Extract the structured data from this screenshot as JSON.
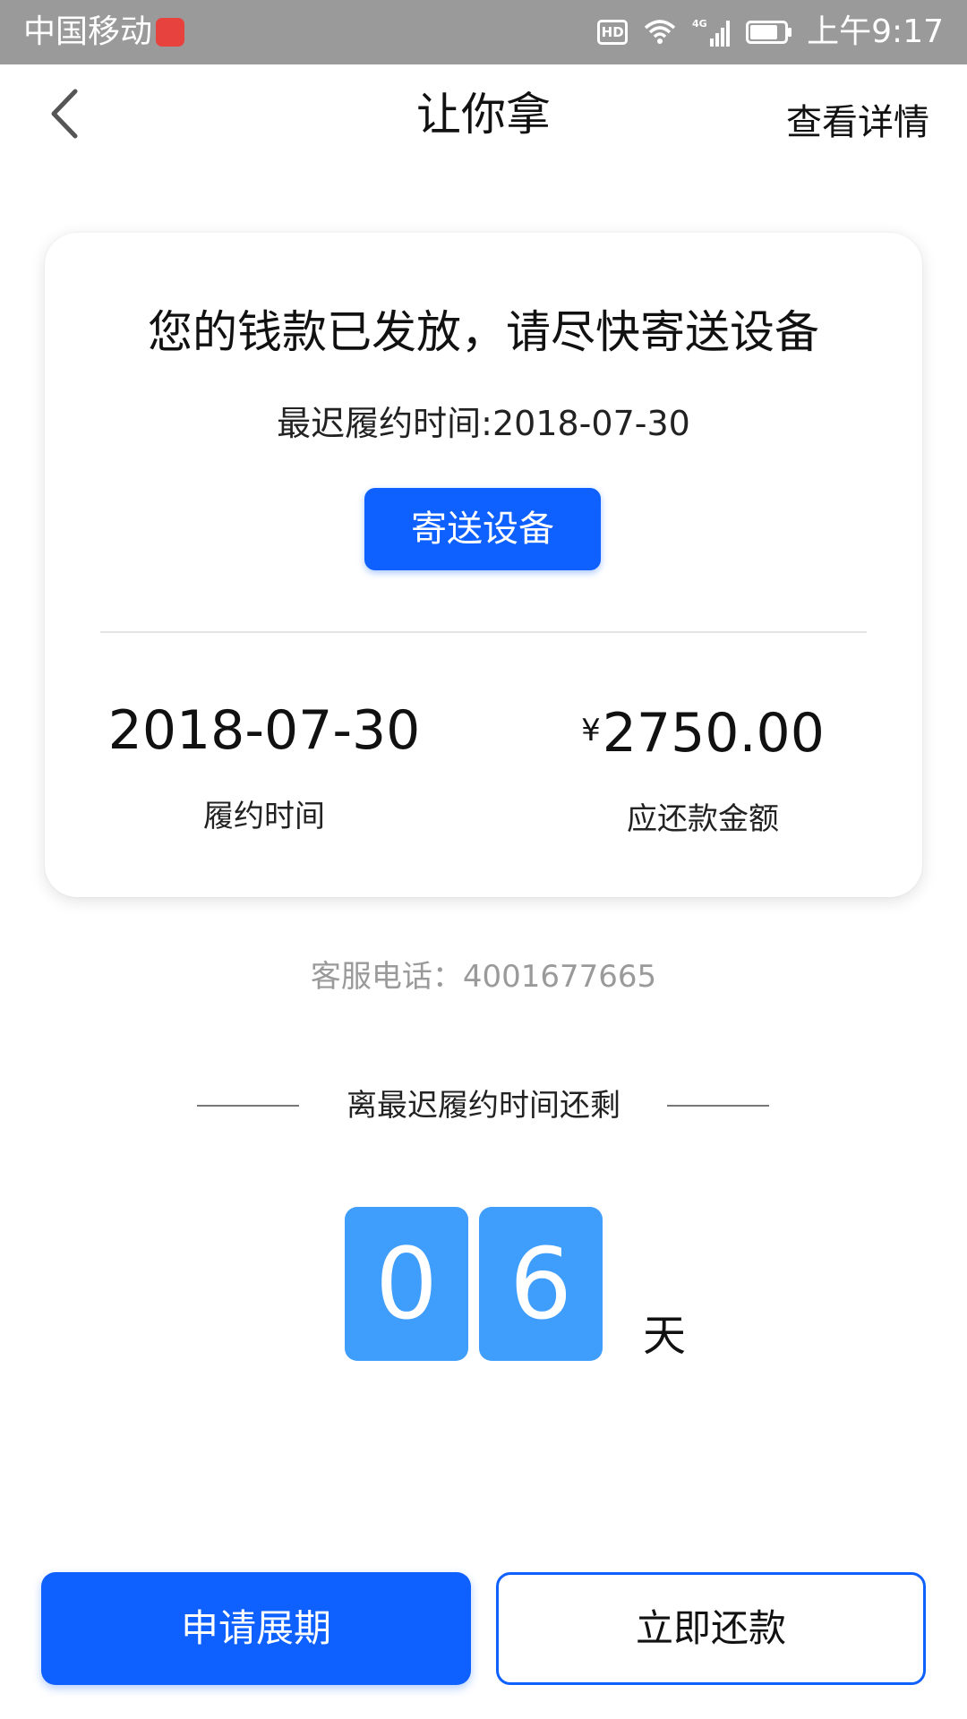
{
  "status_bar": {
    "carrier": "中国移动",
    "network_badge": "HD",
    "network_type": "4G",
    "time": "上午9:17",
    "colors": {
      "background": "#9a9a9a",
      "text": "#ffffff",
      "app_badge": "#e8423f"
    }
  },
  "nav": {
    "title": "让你拿",
    "right_link": "查看详情",
    "back_icon": "chevron-left-icon"
  },
  "card": {
    "headline": "您的钱款已发放，请尽快寄送设备",
    "deadline": "最迟履约时间:2018-07-30",
    "send_button": "寄送设备",
    "stats": {
      "due_date_value": "2018-07-30",
      "due_date_label": "履约时间",
      "amount_currency": "¥",
      "amount_value": "2750.00",
      "amount_label": "应还款金额"
    }
  },
  "hotline": "客服电话：4001677665",
  "countdown": {
    "heading": "离最迟履约时间还剩",
    "digits": [
      "0",
      "6"
    ],
    "unit": "天"
  },
  "actions": {
    "extend": "申请展期",
    "repay": "立即还款"
  },
  "theme": {
    "primary": "#0f61ff",
    "countdown_tile": "#3f9dfb",
    "muted_text": "#9a9a9a"
  }
}
